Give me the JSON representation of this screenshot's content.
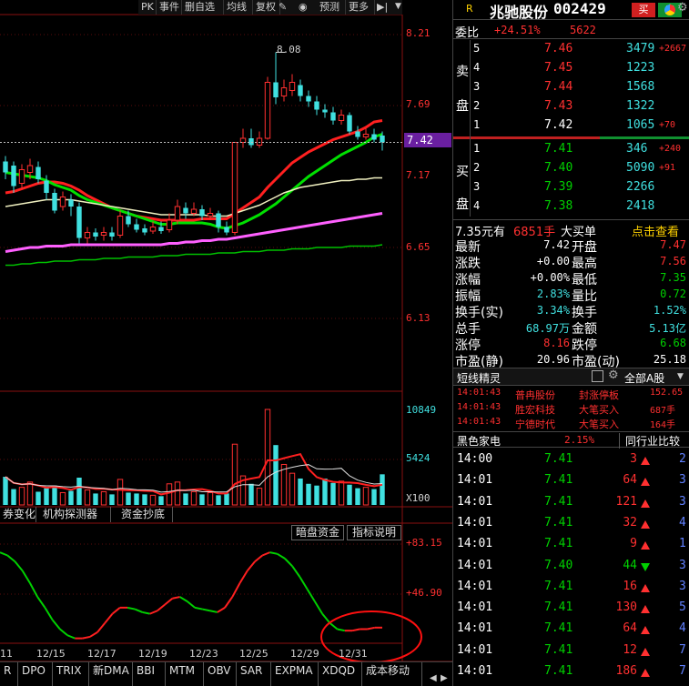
{
  "toolbar": {
    "buttons": [
      "PK",
      "事件",
      "删自选",
      "均线",
      "复权",
      "叠",
      "预测",
      "更多"
    ]
  },
  "price_axis": [
    "8.21",
    "7.69",
    "7.42",
    "7.17",
    "6.65",
    "6.13"
  ],
  "peak_label": "8.08",
  "volume_axis": [
    "10849",
    "5424",
    "X100"
  ],
  "indicator_axis": [
    "+83.15",
    "+46.90"
  ],
  "dates": [
    "11",
    "12/15",
    "12/17",
    "12/19",
    "12/23",
    "12/25",
    "12/29",
    "12/31"
  ],
  "subtabs": [
    "券变化",
    "机构探测器",
    "资金抄底"
  ],
  "indicator_buttons": [
    "暗盘资金",
    "指标说明"
  ],
  "bottom_tabs": [
    "R",
    "DPO",
    "TRIX",
    "新DMA",
    "BBI",
    "MTM",
    "OBV",
    "SAR",
    "EXPMA",
    "XDQD",
    "成本移动"
  ],
  "chart_data": {
    "type": "candlestick",
    "title": "",
    "current_price": 7.42,
    "ylim": [
      6.13,
      8.21
    ],
    "high_mark": 8.08,
    "candles": [
      {
        "o": 7.28,
        "c": 7.2,
        "h": 7.32,
        "l": 7.15
      },
      {
        "o": 7.25,
        "c": 7.1,
        "h": 7.28,
        "l": 7.05
      },
      {
        "o": 7.12,
        "c": 7.22,
        "h": 7.26,
        "l": 7.08
      },
      {
        "o": 7.2,
        "c": 7.25,
        "h": 7.3,
        "l": 7.15
      },
      {
        "o": 7.24,
        "c": 7.15,
        "h": 7.28,
        "l": 7.12
      },
      {
        "o": 7.14,
        "c": 7.05,
        "h": 7.18,
        "l": 7.0
      },
      {
        "o": 7.05,
        "c": 6.92,
        "h": 7.08,
        "l": 6.9
      },
      {
        "o": 6.95,
        "c": 7.02,
        "h": 7.06,
        "l": 6.92
      },
      {
        "o": 7.0,
        "c": 6.95,
        "h": 7.04,
        "l": 6.88
      },
      {
        "o": 6.95,
        "c": 6.72,
        "h": 6.98,
        "l": 6.68
      },
      {
        "o": 6.72,
        "c": 6.76,
        "h": 6.8,
        "l": 6.68
      },
      {
        "o": 6.76,
        "c": 6.73,
        "h": 6.79,
        "l": 6.7
      },
      {
        "o": 6.74,
        "c": 6.76,
        "h": 6.8,
        "l": 6.7
      },
      {
        "o": 6.76,
        "c": 6.73,
        "h": 6.8,
        "l": 6.7
      },
      {
        "o": 6.74,
        "c": 6.88,
        "h": 6.92,
        "l": 6.72
      },
      {
        "o": 6.88,
        "c": 6.82,
        "h": 6.92,
        "l": 6.8
      },
      {
        "o": 6.82,
        "c": 6.78,
        "h": 6.86,
        "l": 6.76
      },
      {
        "o": 6.79,
        "c": 6.76,
        "h": 6.82,
        "l": 6.74
      },
      {
        "o": 6.77,
        "c": 6.8,
        "h": 6.84,
        "l": 6.75
      },
      {
        "o": 6.8,
        "c": 6.77,
        "h": 6.84,
        "l": 6.75
      },
      {
        "o": 6.78,
        "c": 6.85,
        "h": 6.9,
        "l": 6.76
      },
      {
        "o": 6.85,
        "c": 6.95,
        "h": 7.0,
        "l": 6.82
      },
      {
        "o": 6.94,
        "c": 6.9,
        "h": 6.98,
        "l": 6.86
      },
      {
        "o": 6.9,
        "c": 6.93,
        "h": 6.98,
        "l": 6.88
      },
      {
        "o": 6.93,
        "c": 6.88,
        "h": 6.96,
        "l": 6.85
      },
      {
        "o": 6.88,
        "c": 6.9,
        "h": 6.94,
        "l": 6.85
      },
      {
        "o": 6.9,
        "c": 6.8,
        "h": 6.92,
        "l": 6.76
      },
      {
        "o": 6.8,
        "c": 6.76,
        "h": 6.84,
        "l": 6.74
      },
      {
        "o": 6.76,
        "c": 7.42,
        "h": 7.42,
        "l": 6.74
      },
      {
        "o": 7.42,
        "c": 7.45,
        "h": 7.52,
        "l": 7.38
      },
      {
        "o": 7.45,
        "c": 7.4,
        "h": 7.52,
        "l": 7.38
      },
      {
        "o": 7.4,
        "c": 7.45,
        "h": 7.5,
        "l": 7.38
      },
      {
        "o": 7.45,
        "c": 7.86,
        "h": 7.9,
        "l": 7.44
      },
      {
        "o": 7.86,
        "c": 7.75,
        "h": 8.08,
        "l": 7.7
      },
      {
        "o": 7.76,
        "c": 7.82,
        "h": 7.88,
        "l": 7.72
      },
      {
        "o": 7.8,
        "c": 7.86,
        "h": 7.92,
        "l": 7.76
      },
      {
        "o": 7.84,
        "c": 7.76,
        "h": 7.88,
        "l": 7.72
      },
      {
        "o": 7.76,
        "c": 7.72,
        "h": 7.8,
        "l": 7.68
      },
      {
        "o": 7.72,
        "c": 7.66,
        "h": 7.76,
        "l": 7.62
      },
      {
        "o": 7.66,
        "c": 7.64,
        "h": 7.7,
        "l": 7.6
      },
      {
        "o": 7.64,
        "c": 7.58,
        "h": 7.68,
        "l": 7.55
      },
      {
        "o": 7.58,
        "c": 7.62,
        "h": 7.66,
        "l": 7.55
      },
      {
        "o": 7.62,
        "c": 7.5,
        "h": 7.64,
        "l": 7.48
      },
      {
        "o": 7.5,
        "c": 7.46,
        "h": 7.54,
        "l": 7.44
      },
      {
        "o": 7.46,
        "c": 7.48,
        "h": 7.52,
        "l": 7.44
      },
      {
        "o": 7.48,
        "c": 7.44,
        "h": 7.52,
        "l": 7.42
      },
      {
        "o": 7.47,
        "c": 7.42,
        "h": 7.5,
        "l": 7.36
      }
    ],
    "volumes": [
      3200,
      1800,
      2000,
      2600,
      1500,
      1900,
      2200,
      1400,
      1600,
      3100,
      1700,
      1300,
      1500,
      1200,
      2900,
      1400,
      1300,
      1200,
      1100,
      1000,
      2400,
      2600,
      1300,
      1500,
      1200,
      1400,
      1100,
      1300,
      6900,
      3300,
      2400,
      1900,
      10849,
      6800,
      4600,
      3600,
      3000,
      2400,
      2200,
      3000,
      2500,
      2700,
      2300,
      1900,
      2000,
      1800,
      3479
    ],
    "ma_lines": [
      {
        "color": "#ff2020",
        "values": [
          7.05,
          7.06,
          7.08,
          7.1,
          7.12,
          7.13,
          7.13,
          7.12,
          7.1,
          7.07,
          7.03,
          7.0,
          6.97,
          6.94,
          6.92,
          6.9,
          6.88,
          6.87,
          6.86,
          6.85,
          6.85,
          6.85,
          6.85,
          6.85,
          6.86,
          6.86,
          6.86,
          6.86,
          6.9,
          6.94,
          6.98,
          7.02,
          7.09,
          7.15,
          7.21,
          7.27,
          7.31,
          7.35,
          7.38,
          7.41,
          7.44,
          7.46,
          7.48,
          7.5,
          7.53,
          7.57,
          7.58
        ]
      },
      {
        "color": "#00e000",
        "values": [
          7.2,
          7.19,
          7.18,
          7.17,
          7.16,
          7.14,
          7.11,
          7.09,
          7.07,
          7.03,
          7.0,
          6.98,
          6.96,
          6.94,
          6.92,
          6.9,
          6.88,
          6.86,
          6.84,
          6.82,
          6.82,
          6.83,
          6.83,
          6.83,
          6.83,
          6.82,
          6.8,
          6.79,
          6.81,
          6.83,
          6.86,
          6.89,
          6.93,
          6.97,
          7.02,
          7.07,
          7.12,
          7.17,
          7.21,
          7.25,
          7.29,
          7.33,
          7.36,
          7.39,
          7.42,
          7.46,
          7.48
        ]
      },
      {
        "color": "#f0f0c0",
        "values": [
          6.95,
          6.96,
          6.97,
          6.98,
          6.99,
          7.0,
          7.0,
          7.0,
          7.0,
          6.99,
          6.98,
          6.97,
          6.96,
          6.95,
          6.94,
          6.93,
          6.92,
          6.91,
          6.9,
          6.89,
          6.89,
          6.89,
          6.89,
          6.89,
          6.89,
          6.88,
          6.88,
          6.88,
          6.9,
          6.92,
          6.94,
          6.96,
          6.99,
          7.02,
          7.05,
          7.07,
          7.09,
          7.1,
          7.11,
          7.12,
          7.13,
          7.14,
          7.14,
          7.15,
          7.15,
          7.16,
          7.16
        ]
      },
      {
        "color": "#ff60ff",
        "values": [
          6.62,
          6.63,
          6.64,
          6.65,
          6.65,
          6.66,
          6.66,
          6.66,
          6.67,
          6.67,
          6.67,
          6.67,
          6.67,
          6.67,
          6.67,
          6.67,
          6.67,
          6.67,
          6.67,
          6.67,
          6.68,
          6.68,
          6.69,
          6.69,
          6.7,
          6.7,
          6.71,
          6.71,
          6.72,
          6.73,
          6.74,
          6.75,
          6.76,
          6.77,
          6.78,
          6.79,
          6.8,
          6.81,
          6.82,
          6.83,
          6.84,
          6.85,
          6.86,
          6.87,
          6.88,
          6.89,
          6.9
        ]
      },
      {
        "color": "#00c000",
        "values": [
          6.52,
          6.52,
          6.53,
          6.53,
          6.54,
          6.54,
          6.55,
          6.55,
          6.55,
          6.56,
          6.56,
          6.56,
          6.57,
          6.57,
          6.57,
          6.58,
          6.58,
          6.58,
          6.58,
          6.59,
          6.59,
          6.59,
          6.6,
          6.6,
          6.6,
          6.6,
          6.61,
          6.61,
          6.61,
          6.62,
          6.62,
          6.62,
          6.63,
          6.63,
          6.63,
          6.64,
          6.64,
          6.64,
          6.65,
          6.65,
          6.65,
          6.65,
          6.66,
          6.66,
          6.66,
          6.66,
          6.67
        ]
      }
    ],
    "indicator": [
      84,
      82,
      78,
      72,
      64,
      55,
      48,
      40,
      34,
      30,
      28,
      28,
      29,
      32,
      38,
      44,
      48,
      48,
      47,
      45,
      44,
      46,
      50,
      54,
      55,
      52,
      48,
      47,
      46,
      45,
      48,
      55,
      64,
      72,
      78,
      82,
      84,
      83,
      80,
      75,
      68,
      60,
      52,
      44,
      38,
      34,
      33,
      33,
      34,
      34,
      35,
      35
    ],
    "indicator_ylim": [
      26,
      90
    ]
  },
  "stock": {
    "name": "兆驰股份",
    "code": "002429",
    "r_label": "R",
    "buy_btn": "买",
    "sell_btn": "卖"
  },
  "weibi": {
    "label": "委比",
    "value": "+24.51%",
    "diff": "5622"
  },
  "sell_side_label": [
    "卖",
    "盘"
  ],
  "buy_side_label": [
    "买",
    "盘"
  ],
  "asks": [
    {
      "level": "5",
      "price": "7.46",
      "vol": "3479",
      "chg": "+2667"
    },
    {
      "level": "4",
      "price": "7.45",
      "vol": "1223",
      "chg": ""
    },
    {
      "level": "3",
      "price": "7.44",
      "vol": "1568",
      "chg": ""
    },
    {
      "level": "2",
      "price": "7.43",
      "vol": "1322",
      "chg": ""
    },
    {
      "level": "1",
      "price": "7.42",
      "vol": "1065",
      "chg": "+70"
    }
  ],
  "bids": [
    {
      "level": "1",
      "price": "7.41",
      "vol": "346",
      "chg": "+240"
    },
    {
      "level": "2",
      "price": "7.40",
      "vol": "5090",
      "chg": "+91"
    },
    {
      "level": "3",
      "price": "7.39",
      "vol": "2266",
      "chg": ""
    },
    {
      "level": "4",
      "price": "7.38",
      "vol": "2418",
      "chg": ""
    }
  ],
  "big_order": {
    "price": "7.35元有",
    "amount": "6851手",
    "type": "大买单",
    "link": "点击查看"
  },
  "stats": [
    {
      "l1": "最新",
      "v1": "7.42",
      "c1": "white",
      "l2": "开盘",
      "v2": "7.47",
      "c2": "red"
    },
    {
      "l1": "涨跌",
      "v1": "+0.00",
      "c1": "white",
      "l2": "最高",
      "v2": "7.56",
      "c2": "red"
    },
    {
      "l1": "涨幅",
      "v1": "+0.00%",
      "c1": "white",
      "l2": "最低",
      "v2": "7.35",
      "c2": "green"
    },
    {
      "l1": "振幅",
      "v1": "2.83%",
      "c1": "cyan",
      "l2": "量比",
      "v2": "0.72",
      "c2": "green"
    },
    {
      "l1": "换手(实)",
      "v1": "3.34%",
      "c1": "cyan",
      "l2": "换手",
      "v2": "1.52%",
      "c2": "cyan"
    },
    {
      "l1": "总手",
      "v1": "68.97万",
      "c1": "cyan",
      "l2": "金额",
      "v2": "5.13亿",
      "c2": "cyan"
    },
    {
      "l1": "涨停",
      "v1": "8.16",
      "c1": "red",
      "l2": "跌停",
      "v2": "6.68",
      "c2": "green"
    },
    {
      "l1": "市盈(静)",
      "v1": "20.96",
      "c1": "white",
      "l2": "市盈(动)",
      "v2": "25.18",
      "c2": "white"
    }
  ],
  "sprite": {
    "title": "短线精灵",
    "market": "全部A股"
  },
  "sprite_items": [
    {
      "time": "14:01:43",
      "stock": "普冉股份",
      "event": "封涨停板",
      "val": "152.65"
    },
    {
      "time": "14:01:43",
      "stock": "胜宏科技",
      "event": "大笔买入",
      "val": "687手"
    },
    {
      "time": "14:01:43",
      "stock": "宁德时代",
      "event": "大笔买入",
      "val": "164手"
    }
  ],
  "sector": {
    "name": "黑色家电",
    "pct": "2.15%",
    "compare": "同行业比较"
  },
  "ticks": [
    {
      "time": "14:00",
      "price": "7.41",
      "vol": "3",
      "dir": "up",
      "n": "2"
    },
    {
      "time": "14:01",
      "price": "7.41",
      "vol": "64",
      "dir": "up",
      "n": "3"
    },
    {
      "time": "14:01",
      "price": "7.41",
      "vol": "121",
      "dir": "up",
      "n": "3"
    },
    {
      "time": "14:01",
      "price": "7.41",
      "vol": "32",
      "dir": "up",
      "n": "4"
    },
    {
      "time": "14:01",
      "price": "7.41",
      "vol": "9",
      "dir": "up",
      "n": "1"
    },
    {
      "time": "14:01",
      "price": "7.40",
      "vol": "44",
      "dir": "down",
      "n": "3"
    },
    {
      "time": "14:01",
      "price": "7.41",
      "vol": "16",
      "dir": "up",
      "n": "3"
    },
    {
      "time": "14:01",
      "price": "7.41",
      "vol": "130",
      "dir": "up",
      "n": "5"
    },
    {
      "time": "14:01",
      "price": "7.41",
      "vol": "64",
      "dir": "up",
      "n": "4"
    },
    {
      "time": "14:01",
      "price": "7.41",
      "vol": "12",
      "dir": "up",
      "n": "7"
    },
    {
      "time": "14:01",
      "price": "7.41",
      "vol": "186",
      "dir": "up",
      "n": "7"
    }
  ]
}
